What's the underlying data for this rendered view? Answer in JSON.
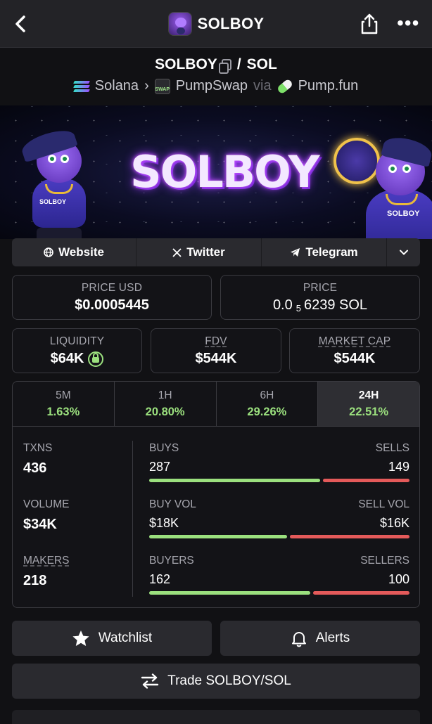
{
  "header": {
    "title": "SOLBOY"
  },
  "pair": {
    "base": "SOLBOY",
    "separator": "/",
    "quote": "SOL",
    "chain": "Solana",
    "dex": "PumpSwap",
    "dex_badge": "SWAP",
    "via": "via",
    "launchpad": "Pump.fun"
  },
  "banner": {
    "title": "SOLBOY",
    "mascot_badge": "SOLBOY"
  },
  "links": [
    {
      "label": "Website",
      "icon": "globe-icon"
    },
    {
      "label": "Twitter",
      "icon": "x-icon"
    },
    {
      "label": "Telegram",
      "icon": "telegram-icon"
    }
  ],
  "price": {
    "usd_label": "PRICE USD",
    "usd_value": "$0.0005445",
    "native_label": "PRICE",
    "native_prefix": "0.0",
    "native_zeros": "5",
    "native_digits": "6239 SOL"
  },
  "metrics": {
    "liquidity_label": "LIQUIDITY",
    "liquidity_value": "$64K",
    "fdv_label": "FDV",
    "fdv_value": "$544K",
    "mcap_label": "MARKET CAP",
    "mcap_value": "$544K"
  },
  "timeframes": [
    {
      "key": "5M",
      "change": "1.63%"
    },
    {
      "key": "1H",
      "change": "20.80%"
    },
    {
      "key": "6H",
      "change": "29.26%"
    },
    {
      "key": "24H",
      "change": "22.51%",
      "active": true
    }
  ],
  "stats": {
    "txns_label": "TXNS",
    "txns": "436",
    "volume_label": "VOLUME",
    "volume": "$34K",
    "makers_label": "MAKERS",
    "makers": "218",
    "buys_label": "BUYS",
    "buys": "287",
    "sells_label": "SELLS",
    "sells": "149",
    "buyvol_label": "BUY VOL",
    "buyvol": "$18K",
    "sellvol_label": "SELL VOL",
    "sellvol": "$16K",
    "buyers_label": "BUYERS",
    "buyers": "162",
    "sellers_label": "SELLERS",
    "sellers": "100",
    "buys_share": 0.658,
    "buyvol_share": 0.53,
    "buyers_share": 0.618
  },
  "actions": {
    "watchlist": "Watchlist",
    "alerts": "Alerts",
    "trade": "Trade SOLBOY/SOL"
  },
  "colors": {
    "positive": "#9be07e",
    "negative": "#e45a5a",
    "surface": "#2a2a2f"
  }
}
